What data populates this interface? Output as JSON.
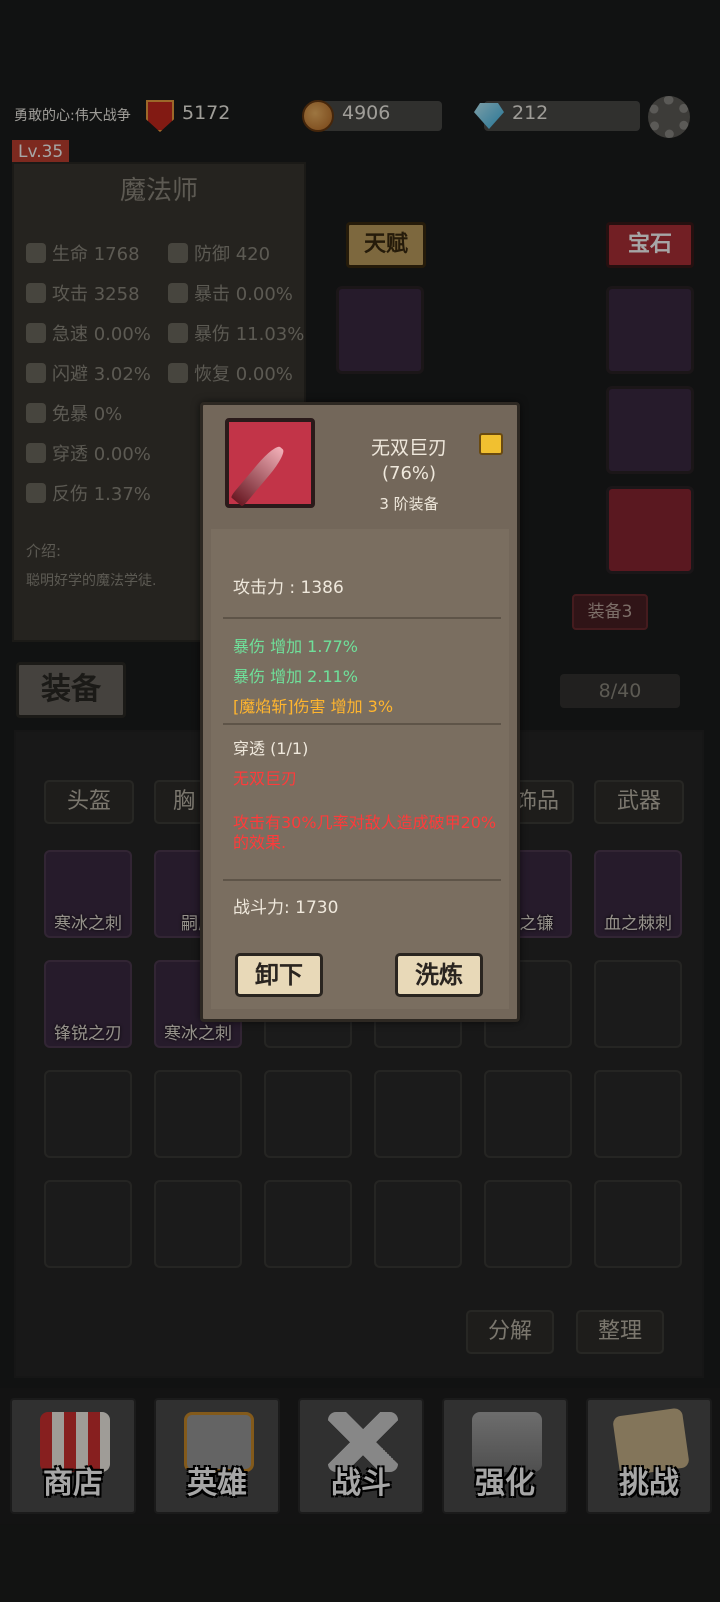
{
  "topbar": {
    "title": "勇敢的心:伟大战争",
    "power": "5172",
    "gold": "4906",
    "gems": "212",
    "level": "Lv.35"
  },
  "hero": {
    "class": "魔法师",
    "stats": [
      {
        "label": "生命 1768"
      },
      {
        "label": "防御 420"
      },
      {
        "label": "攻击 3258"
      },
      {
        "label": "暴击 0.00%"
      },
      {
        "label": "急速 0.00%"
      },
      {
        "label": "暴伤 11.03%"
      },
      {
        "label": "闪避 3.02%"
      },
      {
        "label": "恢复 0.00%"
      },
      {
        "label": "免暴 0%"
      },
      {
        "label": "穿透 0.00%"
      },
      {
        "label": "反伤 1.37%"
      }
    ],
    "intro_label": "介绍:",
    "intro_text": "聪明好学的魔法学徒."
  },
  "side": {
    "talent": "天赋",
    "gem": "宝石",
    "set_label": "装备3"
  },
  "equipment": {
    "title": "装备",
    "count": "8/40",
    "tabs": [
      "头盔",
      "胸",
      "饰品",
      "武器"
    ],
    "items": [
      "寒冰之刺",
      "嗣虎",
      "雷之镰",
      "血之棘刺",
      "锋锐之刃",
      "寒冰之刺"
    ],
    "decompose": "分解",
    "sort": "整理"
  },
  "popup": {
    "name": "无双巨刃",
    "percent": "(76%)",
    "tier": "3 阶装备",
    "attack": "攻击力 : 1386",
    "bonus1": "暴伤 增加 1.77%",
    "bonus2": "暴伤 增加 2.11%",
    "bonus3": "[魔焰斩]伤害 增加 3%",
    "socket": "穿透 (1/1)",
    "socket_name": "无双巨刃",
    "effect": "攻击有30%几率对敌人造成破甲20%的效果.",
    "combat_power": "战斗力: 1730",
    "unequip": "卸下",
    "refine": "洗炼"
  },
  "nav": [
    "商店",
    "英雄",
    "战斗",
    "强化",
    "挑战"
  ]
}
